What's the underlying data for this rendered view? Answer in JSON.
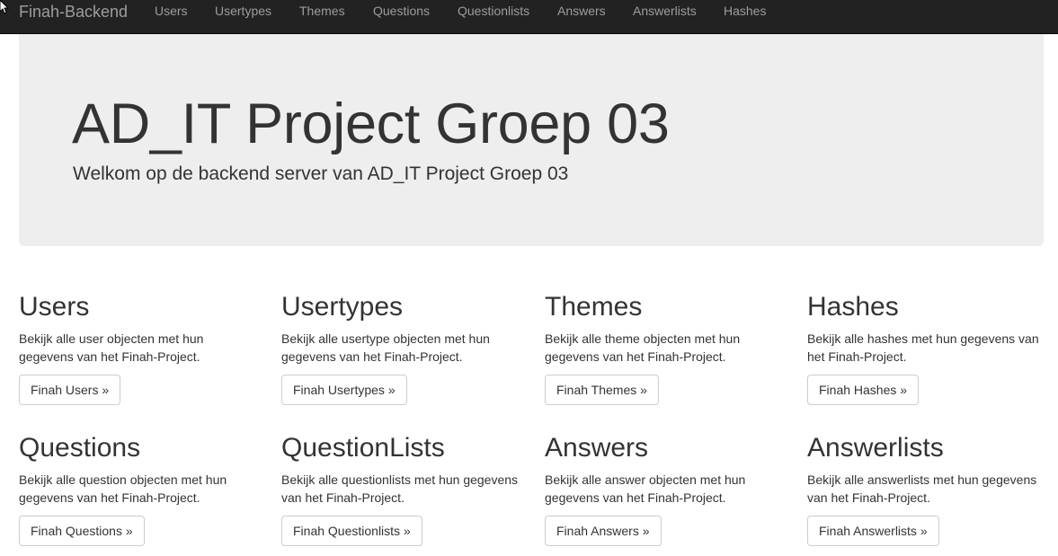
{
  "navbar": {
    "brand": "Finah-Backend",
    "links": [
      {
        "label": "Users"
      },
      {
        "label": "Usertypes"
      },
      {
        "label": "Themes"
      },
      {
        "label": "Questions"
      },
      {
        "label": "Questionlists"
      },
      {
        "label": "Answers"
      },
      {
        "label": "Answerlists"
      },
      {
        "label": "Hashes"
      }
    ]
  },
  "jumbotron": {
    "title": "AD_IT Project Groep 03",
    "lead": "Welkom op de backend server van AD_IT Project Groep 03"
  },
  "cards": [
    {
      "heading": "Users",
      "text": "Bekijk alle user objecten met hun gegevens van het Finah-Project.",
      "button": "Finah Users »"
    },
    {
      "heading": "Usertypes",
      "text": "Bekijk alle usertype objecten met hun gegevens van het Finah-Project.",
      "button": "Finah Usertypes »"
    },
    {
      "heading": "Themes",
      "text": "Bekijk alle theme objecten met hun gegevens van het Finah-Project.",
      "button": "Finah Themes »"
    },
    {
      "heading": "Hashes",
      "text": "Bekijk alle hashes met hun gegevens van het Finah-Project.",
      "button": "Finah Hashes »"
    },
    {
      "heading": "Questions",
      "text": "Bekijk alle question objecten met hun gegevens van het Finah-Project.",
      "button": "Finah Questions »"
    },
    {
      "heading": "QuestionLists",
      "text": "Bekijk alle questionlists met hun gegevens van het Finah-Project.",
      "button": "Finah Questionlists »"
    },
    {
      "heading": "Answers",
      "text": "Bekijk alle answer objecten met hun gegevens van het Finah-Project.",
      "button": "Finah Answers »"
    },
    {
      "heading": "Answerlists",
      "text": "Bekijk alle answerlists met hun gegevens van het Finah-Project.",
      "button": "Finah Answerlists »"
    }
  ]
}
